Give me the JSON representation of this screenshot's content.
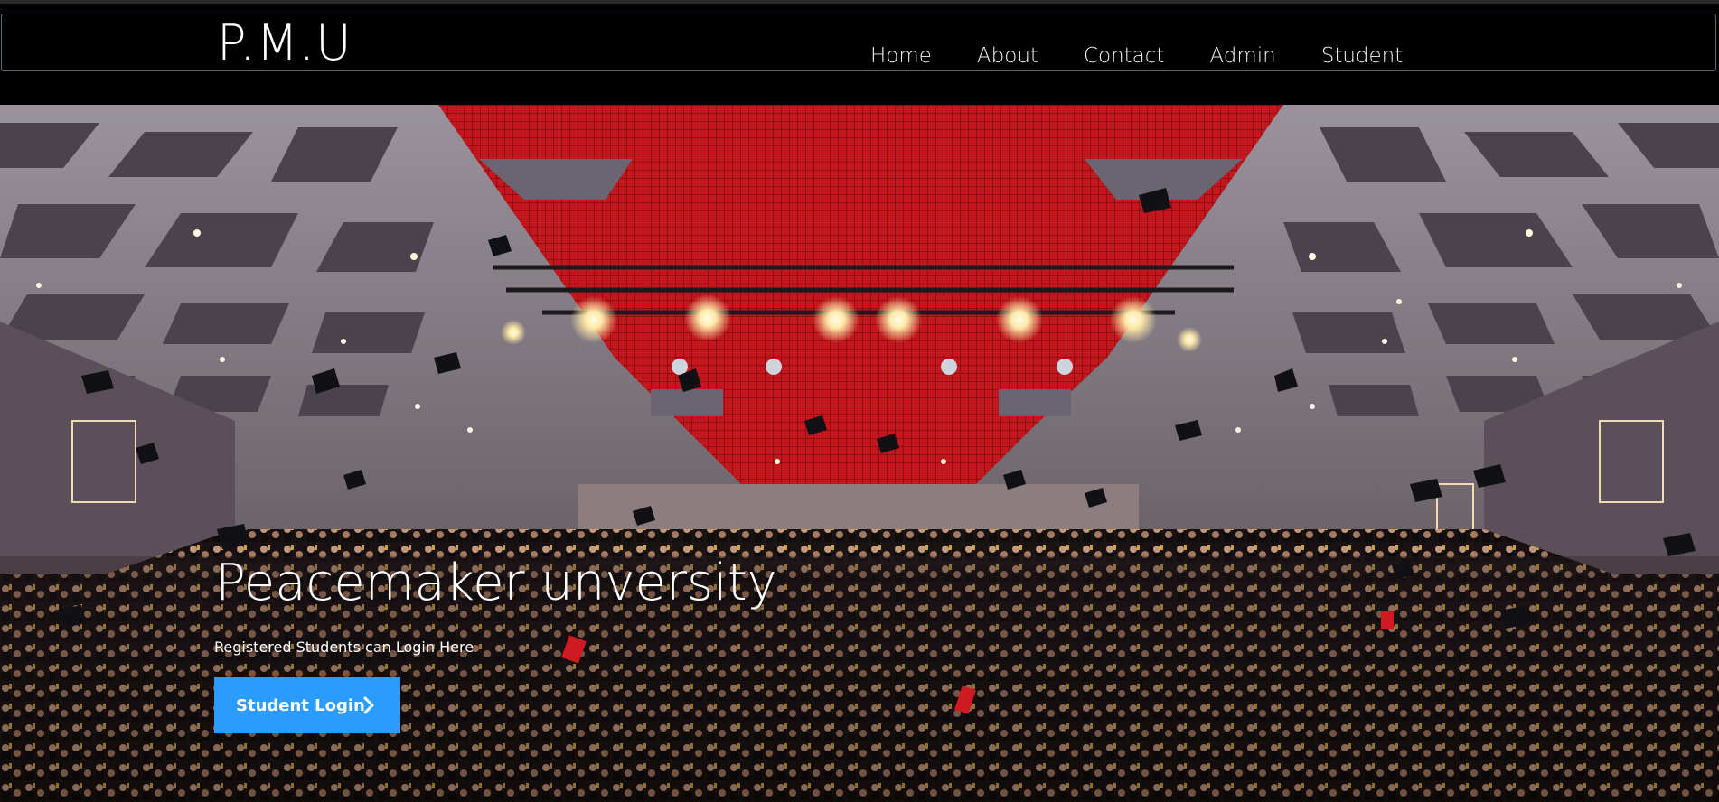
{
  "brand": {
    "name": "P.M.U"
  },
  "nav": {
    "items": [
      "Home",
      "About",
      "Contact",
      "Admin",
      "Student"
    ]
  },
  "hero": {
    "title": "Peacemaker unversity",
    "subtitle": "Registered Students can Login Here",
    "cta_label": "Student Login",
    "cta_icon": "chevron-right-icon",
    "background": "graduation-ceremony-auditorium-photo"
  },
  "colors": {
    "navbar_bg": "#000000",
    "navbar_border": "#4d6a7a",
    "accent": "#2b9cfc",
    "text": "#ffffff",
    "ceiling_red": "#c4161c"
  }
}
